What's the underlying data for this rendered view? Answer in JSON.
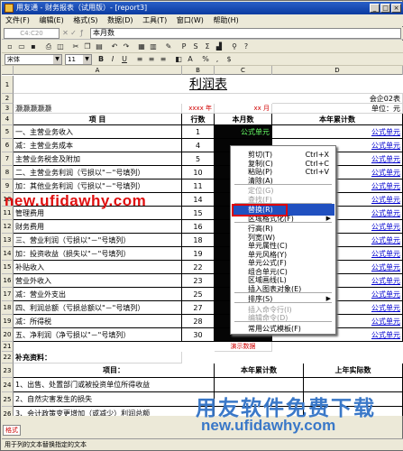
{
  "window": {
    "title": "用友通 - 财务报表（试用版）- [report3]",
    "min": "_",
    "max": "□",
    "close": "×"
  },
  "menu": [
    "文件(F)",
    "编辑(E)",
    "格式(S)",
    "数据(D)",
    "工具(T)",
    "窗口(W)",
    "帮助(H)"
  ],
  "formula_bar": {
    "cell_ref": "C4:C20",
    "input": "本月数"
  },
  "format_bar": {
    "font": "宋体",
    "size": "11"
  },
  "columns": [
    "A",
    "B",
    "C",
    "D"
  ],
  "sheet": {
    "title": "利润表",
    "form_no": "会企02表",
    "unit": "单位：元",
    "company": "灏灏灏灏灏",
    "year_label": "xxxx 年",
    "month_label": "xx 月",
    "headers": {
      "item": "项        目",
      "row_no": "行数",
      "this_month": "本月数",
      "ytd": "本年累计数"
    },
    "rows": [
      {
        "n": "5",
        "item": "一、主营业务收入",
        "row": "1",
        "ytd": "公式单元"
      },
      {
        "n": "6",
        "item": "    减：主营业务成本",
        "row": "4",
        "ytd": "公式单元"
      },
      {
        "n": "7",
        "item": "        主营业务税金及附加",
        "row": "5",
        "ytd": "公式单元"
      },
      {
        "n": "8",
        "item": "二、主营业务利润（亏损以\"－\"号填列）",
        "row": "10",
        "ytd": "公式单元"
      },
      {
        "n": "9",
        "item": "    加：其他业务利润（亏损以\"－\"号填列）",
        "row": "11",
        "ytd": "公式单元"
      },
      {
        "n": "10",
        "item": "",
        "row": "14",
        "ytd": "公式单元"
      },
      {
        "n": "11",
        "item": "        管理费用",
        "row": "15",
        "ytd": "公式单元"
      },
      {
        "n": "12",
        "item": "        财务费用",
        "row": "16",
        "ytd": "公式单元"
      },
      {
        "n": "13",
        "item": "三、营业利润（亏损以\"－\"号填列）",
        "row": "18",
        "ytd": "公式单元"
      },
      {
        "n": "14",
        "item": "    加：投资收益（损失以\"－\"号填列）",
        "row": "19",
        "ytd": "公式单元"
      },
      {
        "n": "15",
        "item": "        补贴收入",
        "row": "22",
        "ytd": "公式单元"
      },
      {
        "n": "16",
        "item": "        营业外收入",
        "row": "23",
        "ytd": "公式单元"
      },
      {
        "n": "17",
        "item": "    减：营业外支出",
        "row": "25",
        "ytd": "公式单元"
      },
      {
        "n": "18",
        "item": "四、利润总额（亏损总额以\"－\"号填列）",
        "row": "27",
        "ytd": "公式单元"
      },
      {
        "n": "19",
        "item": "    减：所得税",
        "row": "28",
        "ytd": "公式单元"
      },
      {
        "n": "20",
        "item": "五、净利润（净亏损以\"－\"号填列）",
        "row": "30",
        "ytd": "公式单元"
      }
    ],
    "demo_data": "演示数据",
    "supplement": "补充资料：",
    "supp_headers": {
      "item": "项目：",
      "ytd": "本年累计数",
      "last_year": "上年实际数"
    },
    "supp_rows": [
      {
        "n": "24",
        "item": "1、出售、处置部门或被投资单位所得收益"
      },
      {
        "n": "25",
        "item": "2、自然灾害发生的损失"
      },
      {
        "n": "26",
        "item": "3、会计政策变更增加（或减少）利润总额"
      },
      {
        "n": "27",
        "item": "4、会计估计变更增加（或减少）利润总额"
      }
    ],
    "cell_c5": "公式单元"
  },
  "context_menu": [
    {
      "label": "剪切(T)",
      "shortcut": "Ctrl+X",
      "disabled": false
    },
    {
      "label": "复制(C)",
      "shortcut": "Ctrl+C",
      "disabled": false
    },
    {
      "label": "粘贴(P)",
      "shortcut": "Ctrl+V",
      "disabled": false
    },
    {
      "label": "清除(A)",
      "shortcut": "",
      "disabled": false
    },
    {
      "label": "定位(G)",
      "shortcut": "",
      "disabled": true
    },
    {
      "label": "查找(F)",
      "shortcut": "",
      "disabled": true
    },
    {
      "label": "替换(R)",
      "shortcut": "",
      "disabled": false,
      "highlight": true
    },
    {
      "label": "区域格式化(F)",
      "shortcut": "",
      "disabled": false,
      "submenu": true
    },
    {
      "label": "行高(R)",
      "shortcut": "",
      "disabled": false
    },
    {
      "label": "列宽(W)",
      "shortcut": "",
      "disabled": false
    },
    {
      "label": "单元属性(C)",
      "shortcut": "",
      "disabled": false
    },
    {
      "label": "单元风格(Y)",
      "shortcut": "",
      "disabled": false
    },
    {
      "label": "单元公式(F)",
      "shortcut": "",
      "disabled": false
    },
    {
      "label": "组合单元(C)",
      "shortcut": "",
      "disabled": false
    },
    {
      "label": "区域画线(L)",
      "shortcut": "",
      "disabled": false
    },
    {
      "label": "插入图表对象(E)",
      "shortcut": "",
      "disabled": false
    },
    {
      "label": "排序(S)",
      "shortcut": "",
      "disabled": false,
      "submenu": true
    },
    {
      "label": "插入命令行(I)",
      "shortcut": "",
      "disabled": true
    },
    {
      "label": "编辑命令(D)",
      "shortcut": "",
      "disabled": true
    },
    {
      "label": "常用公式模板(F)",
      "shortcut": "",
      "disabled": false
    }
  ],
  "watermarks": {
    "url_top": "new.ufidawhy.com",
    "slogan": "用友软件免费下载",
    "url_bottom": "new.ufidawhy.com"
  },
  "sheet_tab": "格式",
  "status": "用于列的文本替换指定的文本"
}
